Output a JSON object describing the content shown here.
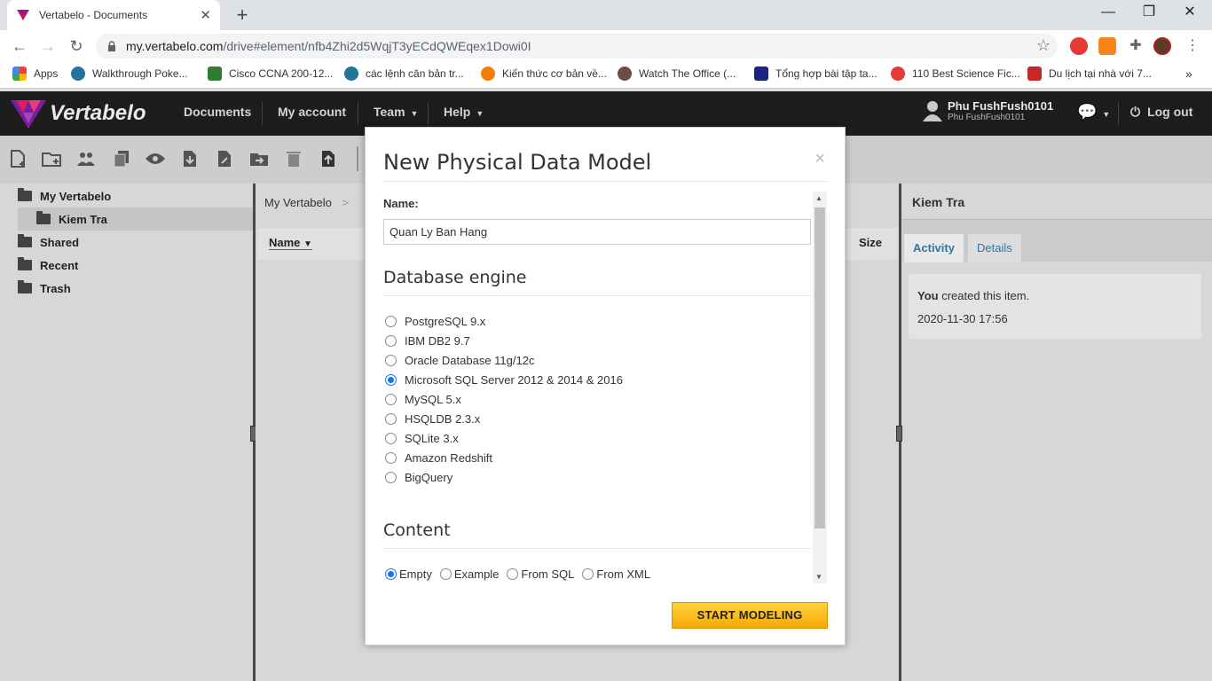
{
  "browser": {
    "tab_title": "Vertabelo - Documents",
    "url_host": "my.vertabelo.com",
    "url_path": "/drive#element/nfb4Zhi2d5WqjT3yECdQWEqex1Dowi0I",
    "bookmarks": [
      {
        "label": "Apps"
      },
      {
        "label": "Walkthrough Poke..."
      },
      {
        "label": "Cisco CCNA 200-12..."
      },
      {
        "label": "các lệnh căn bản tr..."
      },
      {
        "label": "Kiến thức cơ bản về..."
      },
      {
        "label": "Watch The Office (..."
      },
      {
        "label": "Tổng hợp bài tập ta..."
      },
      {
        "label": "110 Best Science Fic..."
      },
      {
        "label": "Du lịch tại nhà với 7..."
      }
    ]
  },
  "app": {
    "logo": "Vertabelo",
    "nav": {
      "documents": "Documents",
      "my_account": "My account",
      "team": "Team",
      "help": "Help"
    },
    "user_name": "Phu FushFush0101",
    "user_sub": "Phu FushFush0101",
    "logout": "Log out"
  },
  "tree": {
    "my_vertabelo": "My Vertabelo",
    "kiem_tra": "Kiem Tra",
    "shared": "Shared",
    "recent": "Recent",
    "trash": "Trash"
  },
  "main": {
    "breadcrumb": "My Vertabelo",
    "breadcrumb_sep": ">",
    "col_name": "Name",
    "col_size": "Size"
  },
  "details": {
    "title": "Kiem Tra",
    "tab_activity": "Activity",
    "tab_details": "Details",
    "activity_actor": "You",
    "activity_text": " created this item.",
    "activity_time": "2020-11-30 17:56"
  },
  "modal": {
    "title": "New Physical Data Model",
    "close": "×",
    "name_label": "Name:",
    "name_value": "Quan Ly Ban Hang",
    "engine_heading": "Database engine",
    "engines": [
      {
        "label": "PostgreSQL 9.x",
        "selected": false
      },
      {
        "label": "IBM DB2 9.7",
        "selected": false
      },
      {
        "label": "Oracle Database 11g/12c",
        "selected": false
      },
      {
        "label": "Microsoft SQL Server 2012 & 2014 & 2016",
        "selected": true
      },
      {
        "label": "MySQL 5.x",
        "selected": false
      },
      {
        "label": "HSQLDB 2.3.x",
        "selected": false
      },
      {
        "label": "SQLite 3.x",
        "selected": false
      },
      {
        "label": "Amazon Redshift",
        "selected": false
      },
      {
        "label": "BigQuery",
        "selected": false
      }
    ],
    "content_heading": "Content",
    "content_options": [
      {
        "label": "Empty",
        "selected": true
      },
      {
        "label": "Example",
        "selected": false
      },
      {
        "label": "From SQL",
        "selected": false
      },
      {
        "label": "From XML",
        "selected": false
      }
    ],
    "start_button": "START MODELING"
  }
}
